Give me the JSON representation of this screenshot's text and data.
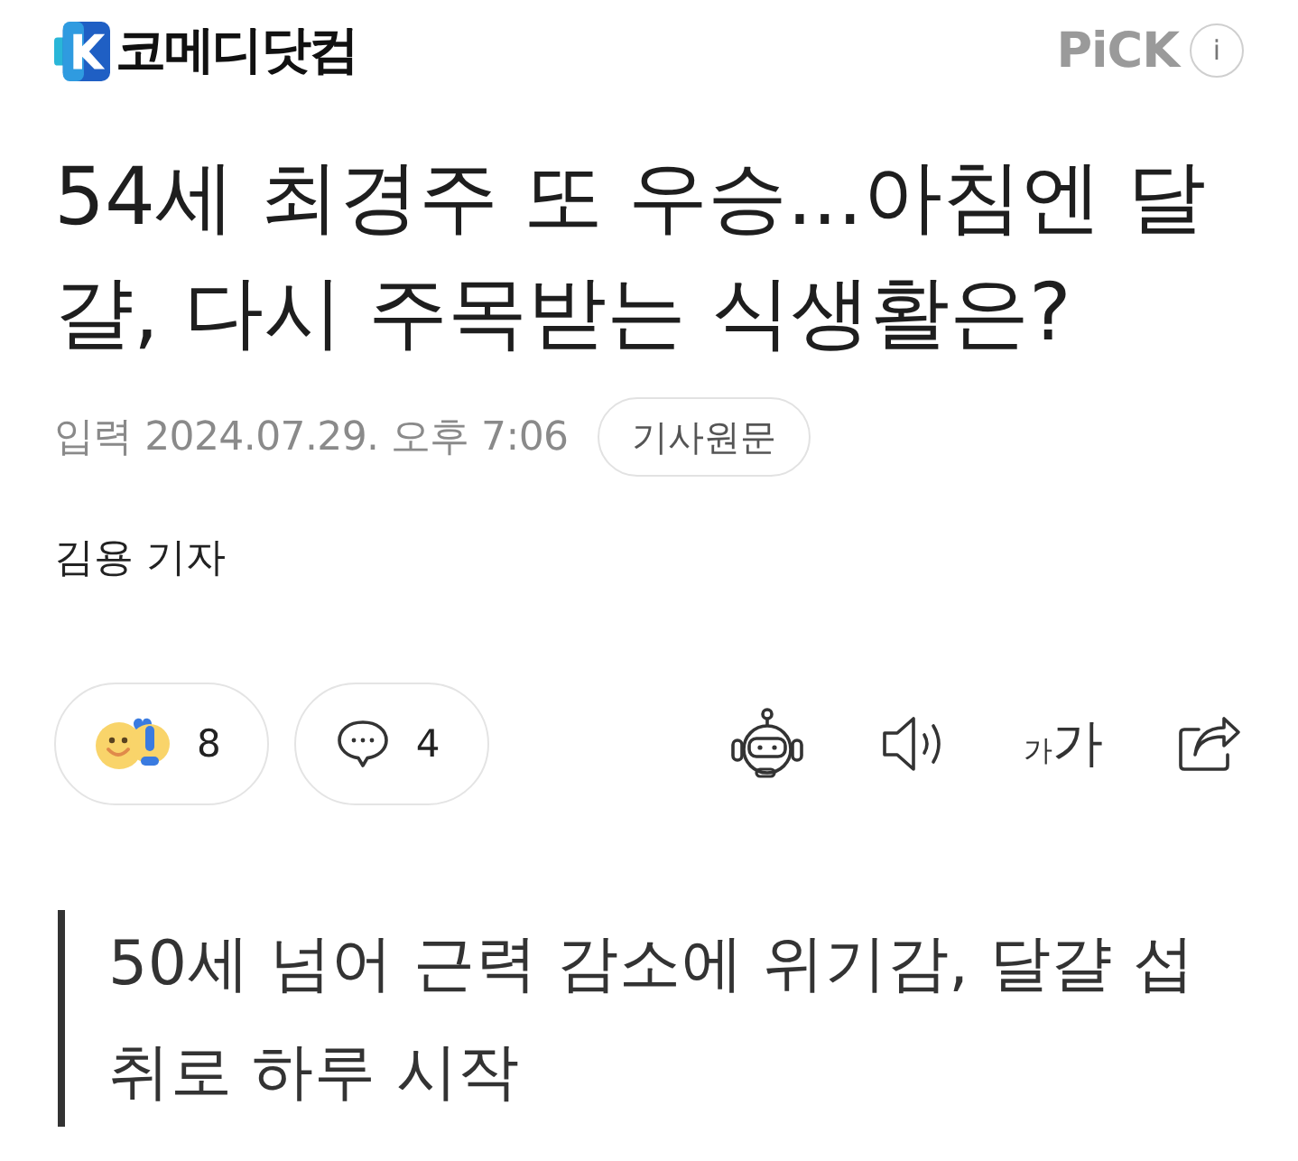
{
  "header": {
    "logo_text": "코메디닷컴",
    "pick_label": "PiCK",
    "info_label": "i"
  },
  "article": {
    "title": "54세 최경주 또 우승...아침엔 달걀, 다시 주목받는 식생활은?",
    "date": "입력 2024.07.29. 오후 7:06",
    "original_button": "기사원문",
    "author": "김용 기자"
  },
  "reactions": {
    "emotion_count": "8",
    "comment_count": "4"
  },
  "toolbar": {
    "font_size_small": "가",
    "font_size_large": "가"
  },
  "subtitle": "50세 넘어 근력 감소에 위기감, 달걀 섭취로 하루 시작"
}
